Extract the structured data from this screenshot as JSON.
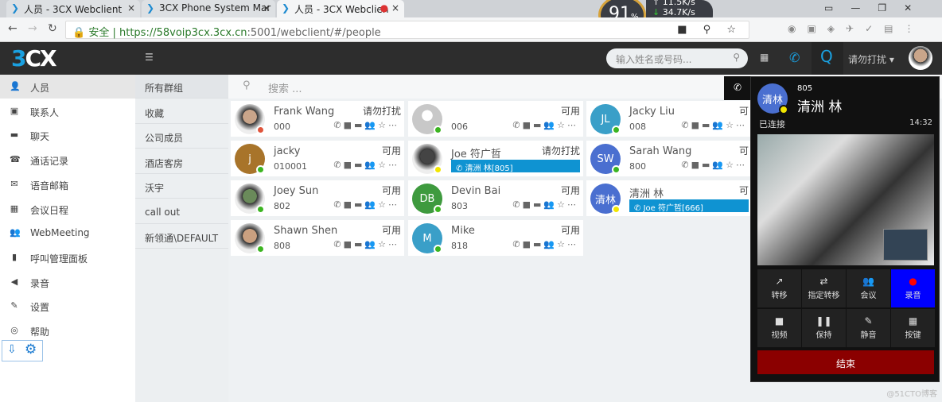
{
  "browser": {
    "tabs": [
      {
        "title": "人员 - 3CX Webclient"
      },
      {
        "title": "3CX Phone System Mar"
      },
      {
        "title": "人员 - 3CX Webclien"
      }
    ],
    "secure_label": "安全",
    "url_host": "https://58voip3cx.3cx.cn",
    "url_rest": ":5001/webclient/#/people",
    "speed": {
      "cpu": "91",
      "unit": "%",
      "up": "11.5K/s",
      "down": "34.7K/s"
    }
  },
  "header": {
    "logo": "3CX",
    "search_placeholder": "输入姓名或号码...",
    "status": "请勿打扰",
    "q": "Q"
  },
  "sidebar": {
    "items": [
      {
        "label": "人员",
        "icon": "person-icon",
        "glyph": "👤"
      },
      {
        "label": "联系人",
        "icon": "contacts-icon",
        "glyph": "▣"
      },
      {
        "label": "聊天",
        "icon": "chat-icon",
        "glyph": "▬"
      },
      {
        "label": "通话记录",
        "icon": "call-log-icon",
        "glyph": "☎"
      },
      {
        "label": "语音邮箱",
        "icon": "voicemail-icon",
        "glyph": "✉"
      },
      {
        "label": "会议日程",
        "icon": "calendar-icon",
        "glyph": "▦"
      },
      {
        "label": "WebMeeting",
        "icon": "meeting-icon",
        "glyph": "👥"
      },
      {
        "label": "呼叫管理面板",
        "icon": "chart-icon",
        "glyph": "▮"
      },
      {
        "label": "录音",
        "icon": "speaker-icon",
        "glyph": "◀"
      },
      {
        "label": "设置",
        "icon": "wrench-icon",
        "glyph": "✎"
      },
      {
        "label": "帮助",
        "icon": "help-icon",
        "glyph": "◎"
      }
    ]
  },
  "groups": [
    "所有群组",
    "收藏",
    "公司成员",
    "酒店客房",
    "沃宇",
    "call out",
    "新领通\\DEFAULT"
  ],
  "people_search_placeholder": "搜索 ...",
  "contacts": [
    {
      "name": "Frank Wang",
      "ext": "000",
      "status": "请勿打扰",
      "avatar": "photo",
      "color": "#c9a58a",
      "presence": "#e0553c"
    },
    {
      "name": "",
      "ext": "006",
      "status": "可用",
      "avatar": "placeholder",
      "color": "#c8c8c8",
      "presence": "#3cb521"
    },
    {
      "name": "Jacky Liu",
      "ext": "008",
      "status": "可",
      "avatar": "JL",
      "color": "#3a9fc8",
      "presence": "#3cb521"
    },
    {
      "name": "jacky",
      "ext": "010001",
      "status": "可用",
      "avatar": "j",
      "color": "#a8742a",
      "presence": "#3cb521"
    },
    {
      "name": "Joe 符广哲",
      "ext": "",
      "status": "请勿打扰",
      "avatar": "photo",
      "color": "#444",
      "presence": "#f2e600",
      "call": "清洲 林[805]"
    },
    {
      "name": "Sarah Wang",
      "ext": "800",
      "status": "可",
      "avatar": "SW",
      "color": "#4a6fd0",
      "presence": "#3cb521"
    },
    {
      "name": "Joey Sun",
      "ext": "802",
      "status": "可用",
      "avatar": "photo",
      "color": "#6a8a5a",
      "presence": "#3cb521"
    },
    {
      "name": "Devin Bai",
      "ext": "803",
      "status": "可用",
      "avatar": "DB",
      "color": "#3e9a3e",
      "presence": "#3cb521"
    },
    {
      "name": "清洲 林",
      "ext": "",
      "status": "可",
      "avatar": "清林",
      "color": "#4a6fd0",
      "presence": "#f2e600",
      "call": "Joe 符广哲[666]"
    },
    {
      "name": "Shawn Shen",
      "ext": "808",
      "status": "可用",
      "avatar": "photo",
      "color": "#caa080",
      "presence": "#3cb521"
    },
    {
      "name": "Mike",
      "ext": "818",
      "status": "可用",
      "avatar": "M",
      "color": "#3a9fc8",
      "presence": "#3cb521"
    }
  ],
  "call": {
    "avatar": "清林",
    "ext": "805",
    "name": "清洲 林",
    "state": "已连接",
    "duration": "14:32",
    "buttons": [
      {
        "label": "转移",
        "glyph": "↗"
      },
      {
        "label": "指定转移",
        "glyph": "⇄"
      },
      {
        "label": "会议",
        "glyph": "👥"
      },
      {
        "label": "录音",
        "glyph": "●",
        "active": true
      },
      {
        "label": "视频",
        "glyph": "■"
      },
      {
        "label": "保持",
        "glyph": "❚❚"
      },
      {
        "label": "静音",
        "glyph": "✎"
      },
      {
        "label": "按键",
        "glyph": "▦"
      }
    ],
    "end_label": "结束",
    "record_color": "#0000ff",
    "end_color": "#8b0000"
  },
  "watermark": "@51CTO博客"
}
